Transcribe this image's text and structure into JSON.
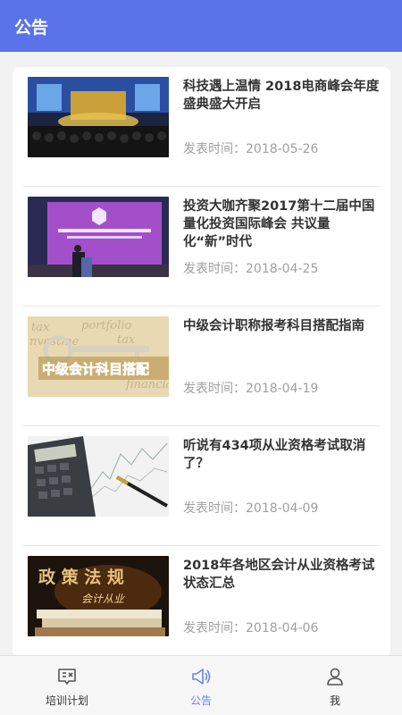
{
  "header": {
    "title": "公告"
  },
  "announcements": [
    {
      "title": "科技遇上温情 2018电商峰会年度盛典盛大开启",
      "date": "发表时间：2018-05-26"
    },
    {
      "title": "投资大咖齐聚2017第十二届中国量化投资国际峰会 共议量化“新”时代",
      "date": "发表时间：2018-04-25"
    },
    {
      "title": "中级会计职称报考科目搭配指南",
      "date": "发表时间：2018-04-19"
    },
    {
      "title": "听说有434项从业资格考试取消了？",
      "date": "发表时间：2018-04-09"
    },
    {
      "title": "2018年各地区会计从业资格考试状态汇总",
      "date": "发表时间：2018-04-06"
    }
  ],
  "thumb_text": {
    "thumb3": "中级会计科目搭配",
    "thumb5_top": "政 策 法 规",
    "thumb5_sub": "会计从业"
  },
  "tabbar": [
    {
      "label": "培训计划",
      "icon": "chat-board-icon"
    },
    {
      "label": "公告",
      "icon": "megaphone-icon",
      "active": true
    },
    {
      "label": "我",
      "icon": "person-icon"
    }
  ],
  "colors": {
    "header": "#5b73e8",
    "active_tab": "#6a83ea"
  }
}
